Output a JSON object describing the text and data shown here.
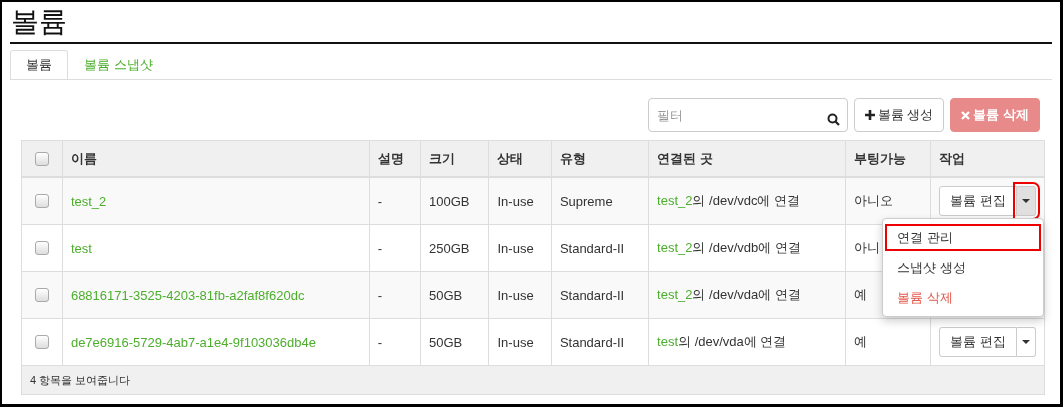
{
  "page_title": "볼륨",
  "tabs": [
    {
      "label": "볼륨",
      "selected": true
    },
    {
      "label": "볼륨 스냅샷",
      "selected": false
    }
  ],
  "filter": {
    "placeholder": "필터"
  },
  "buttons": [
    {
      "label": "볼륨 생성",
      "kind": "create"
    },
    {
      "label": "볼륨 삭제",
      "kind": "delete"
    }
  ],
  "table": {
    "select_all_checked": false,
    "columns": [
      "이름",
      "설명",
      "크기",
      "상태",
      "유형",
      "연결된 곳",
      "부팅가능",
      "작업"
    ],
    "rows": [
      {
        "checked": false,
        "name": "test_2",
        "description": "-",
        "size": "100GB",
        "status": "In-use",
        "type": "Supreme",
        "attached_link": "test_2",
        "attached_rest": "의 /dev/vdc에 연결",
        "bootable": "아니오",
        "action": {
          "label": "볼륨 편집",
          "toggle_highlighted": true
        },
        "menu": [
          {
            "label": "연결 관리",
            "kind": "normal",
            "highlighted": true
          },
          {
            "label": "스냅샷 생성",
            "kind": "normal",
            "highlighted": false
          },
          {
            "label": "볼륨 삭제",
            "kind": "danger",
            "highlighted": false
          }
        ]
      },
      {
        "checked": false,
        "name": "test",
        "description": "-",
        "size": "250GB",
        "status": "In-use",
        "type": "Standard-II",
        "attached_link": "test_2",
        "attached_rest": "의 /dev/vdb에 연결",
        "bootable": "아니"
      },
      {
        "checked": false,
        "name": "68816171-3525-4203-81fb-a2faf8f620dc",
        "description": "-",
        "size": "50GB",
        "status": "In-use",
        "type": "Standard-II",
        "attached_link": "test_2",
        "attached_rest": "의 /dev/vda에 연결",
        "bootable": "예"
      },
      {
        "checked": false,
        "name": "de7e6916-5729-4ab7-a1e4-9f103036db4e",
        "description": "-",
        "size": "50GB",
        "status": "In-use",
        "type": "Standard-II",
        "attached_link": "test",
        "attached_rest": "의 /dev/vda에 연결",
        "bootable": "예",
        "action": {
          "label": "볼륨 편집",
          "toggle_highlighted": false
        }
      }
    ],
    "footer": "4 항목을 보여줍니다"
  }
}
